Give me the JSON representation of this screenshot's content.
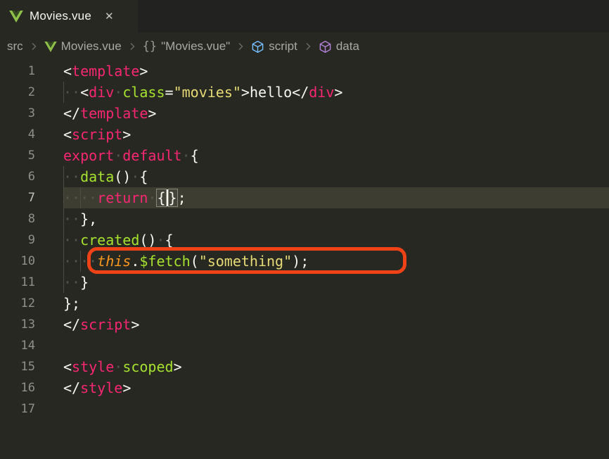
{
  "window": {
    "background": "#272822",
    "tabstrip_background": "#222320"
  },
  "tab": {
    "title": "Movies.vue",
    "icon": "vue-logo",
    "close_glyph": "✕"
  },
  "breadcrumb": {
    "separator": "chevron-right",
    "items": [
      {
        "label": "src"
      },
      {
        "icon": "vue-logo",
        "label": "Movies.vue"
      },
      {
        "icon": "braces",
        "glyph": "{}",
        "label": "\"Movies.vue\""
      },
      {
        "icon": "symbol-cube",
        "color": "#75beff",
        "label": "script"
      },
      {
        "icon": "symbol-cube",
        "color": "#b180d7",
        "label": "data"
      }
    ]
  },
  "colors": {
    "tag": "#f92672",
    "keyword": "#f92672",
    "function": "#a6e22e",
    "attribute": "#a6e22e",
    "string": "#e6db74",
    "text": "#f8f8f2",
    "this_keyword": "#fd971f",
    "whitespace_dot": "#55564e",
    "line_number": "#90908a",
    "active_line_bg": "#3e3d32",
    "annotation_box": "#ef4317",
    "vue_green": "#8dc149",
    "cube_blue": "#75beff",
    "cube_purple": "#b180d7"
  },
  "code": {
    "lines": [
      {
        "num": "1",
        "tokens": [
          [
            "pun",
            "<"
          ],
          [
            "tag",
            "template"
          ],
          [
            "pun",
            ">"
          ]
        ]
      },
      {
        "num": "2",
        "guides": [
          0
        ],
        "tokens": [
          [
            "ws",
            "··"
          ],
          [
            "pun",
            "<"
          ],
          [
            "tag",
            "div"
          ],
          [
            "ws",
            "·"
          ],
          [
            "attr",
            "class"
          ],
          [
            "pun",
            "="
          ],
          [
            "str",
            "\"movies\""
          ],
          [
            "pun",
            ">"
          ],
          [
            "txt",
            "hello"
          ],
          [
            "pun",
            "</"
          ],
          [
            "tag",
            "div"
          ],
          [
            "pun",
            ">"
          ]
        ]
      },
      {
        "num": "3",
        "tokens": [
          [
            "pun",
            "</"
          ],
          [
            "tag",
            "template"
          ],
          [
            "pun",
            ">"
          ]
        ]
      },
      {
        "num": "4",
        "tokens": [
          [
            "pun",
            "<"
          ],
          [
            "tag",
            "script"
          ],
          [
            "pun",
            ">"
          ]
        ]
      },
      {
        "num": "5",
        "tokens": [
          [
            "kw",
            "export"
          ],
          [
            "ws",
            "·"
          ],
          [
            "kw",
            "default"
          ],
          [
            "ws",
            "·"
          ],
          [
            "pun",
            "{"
          ]
        ]
      },
      {
        "num": "6",
        "guides": [
          0
        ],
        "tokens": [
          [
            "ws",
            "··"
          ],
          [
            "fn",
            "data"
          ],
          [
            "pun",
            "()"
          ],
          [
            "ws",
            "·"
          ],
          [
            "pun",
            "{"
          ]
        ]
      },
      {
        "num": "7",
        "active": true,
        "guides": [
          0,
          2
        ],
        "tokens": [
          [
            "ws",
            "····"
          ],
          [
            "kw",
            "return"
          ],
          [
            "ws",
            "·"
          ],
          [
            "brk",
            "{"
          ],
          [
            "cursor",
            ""
          ],
          [
            "brk",
            "}"
          ],
          [
            "pun",
            ";"
          ]
        ]
      },
      {
        "num": "8",
        "guides": [
          0
        ],
        "tokens": [
          [
            "ws",
            "··"
          ],
          [
            "pun",
            "},"
          ]
        ]
      },
      {
        "num": "9",
        "guides": [
          0
        ],
        "tokens": [
          [
            "ws",
            "··"
          ],
          [
            "fn",
            "created"
          ],
          [
            "pun",
            "()"
          ],
          [
            "ws",
            "·"
          ],
          [
            "pun",
            "{"
          ]
        ]
      },
      {
        "num": "10",
        "annotated": true,
        "guides": [
          0,
          2
        ],
        "tokens": [
          [
            "ws",
            "····"
          ],
          [
            "this",
            "this"
          ],
          [
            "pun",
            "."
          ],
          [
            "fn",
            "$fetch"
          ],
          [
            "pun",
            "("
          ],
          [
            "str",
            "\"something\""
          ],
          [
            "pun",
            ")"
          ],
          [
            "pun",
            ";"
          ]
        ]
      },
      {
        "num": "11",
        "guides": [
          0
        ],
        "tokens": [
          [
            "ws",
            "··"
          ],
          [
            "pun",
            "}"
          ]
        ]
      },
      {
        "num": "12",
        "tokens": [
          [
            "pun",
            "};"
          ]
        ]
      },
      {
        "num": "13",
        "tokens": [
          [
            "pun",
            "</"
          ],
          [
            "tag",
            "script"
          ],
          [
            "pun",
            ">"
          ]
        ]
      },
      {
        "num": "14",
        "tokens": []
      },
      {
        "num": "15",
        "tokens": [
          [
            "pun",
            "<"
          ],
          [
            "tag",
            "style"
          ],
          [
            "ws",
            "·"
          ],
          [
            "attr",
            "scoped"
          ],
          [
            "pun",
            ">"
          ]
        ]
      },
      {
        "num": "16",
        "tokens": [
          [
            "pun",
            "</"
          ],
          [
            "tag",
            "style"
          ],
          [
            "pun",
            ">"
          ]
        ]
      },
      {
        "num": "17",
        "tokens": []
      }
    ]
  }
}
